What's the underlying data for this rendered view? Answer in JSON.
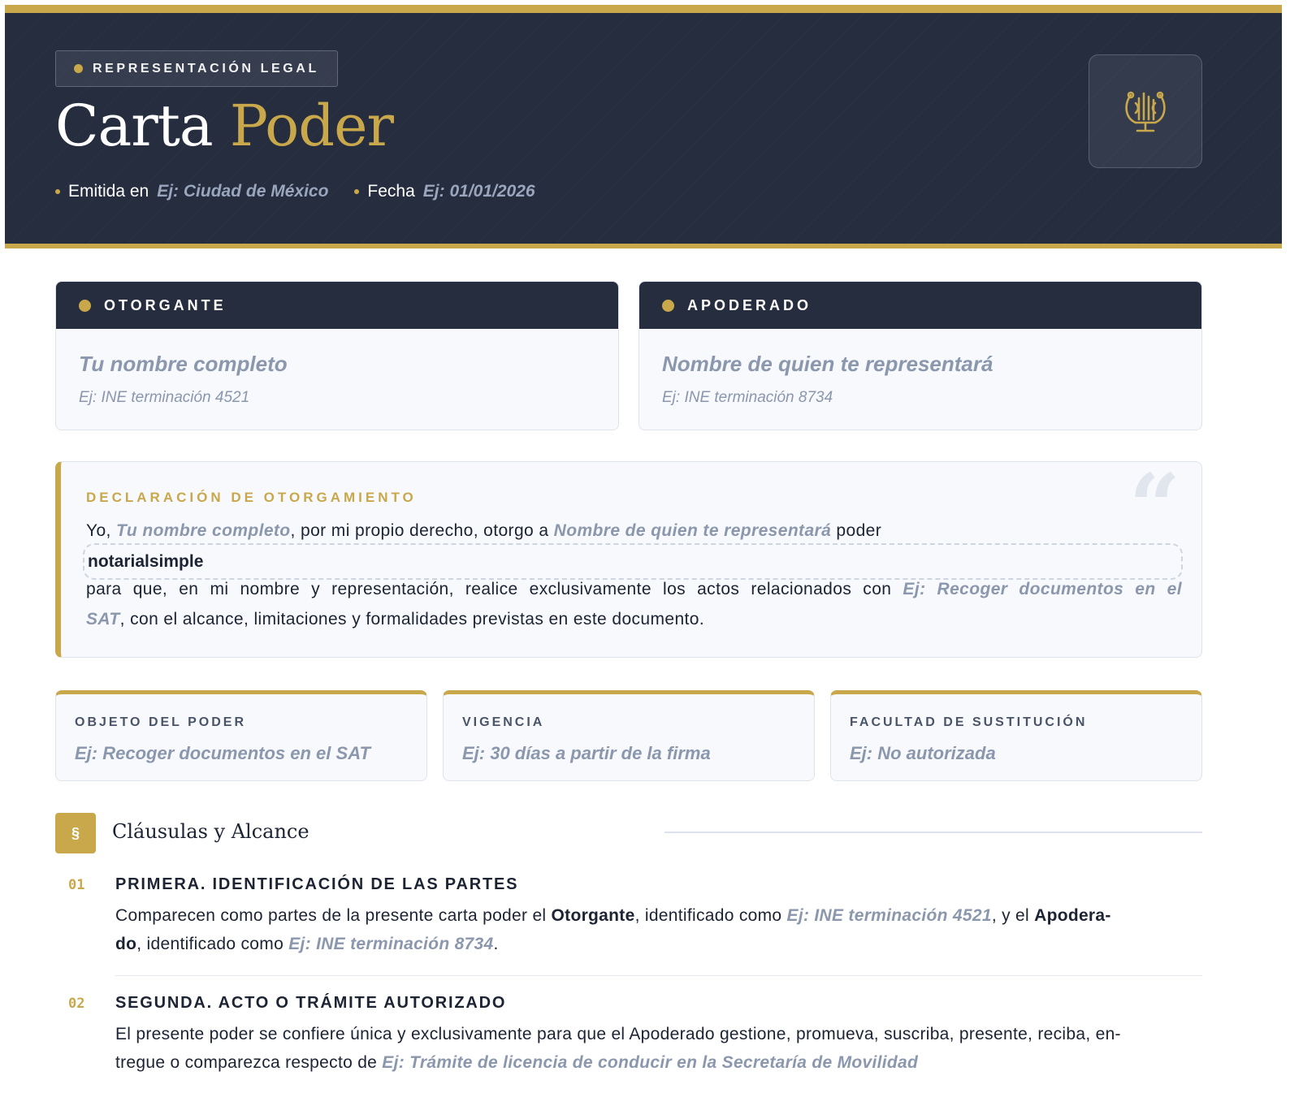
{
  "header": {
    "badge": "REPRESENTACIÓN LEGAL",
    "title_part1": "Carta",
    "title_part2": "Poder",
    "issued_label": "Emitida en",
    "issued_value": "Ej: Ciudad de México",
    "date_label": "Fecha",
    "date_value": "Ej: 01/01/2026",
    "emblem_icon": "lyre-icon"
  },
  "parties": {
    "otorgante": {
      "label": "OTORGANTE",
      "name": "Tu nombre completo",
      "id": "Ej: INE terminación 4521"
    },
    "apoderado": {
      "label": "APODERADO",
      "name": "Nombre de quien te representará",
      "id": "Ej: INE terminación 8734"
    }
  },
  "declaration": {
    "title": "DECLARACIÓN DE OTORGAMIENTO",
    "quote_mark": "“",
    "yo": "Yo,",
    "otorgante": "Tu nombre completo",
    "mid": ", por mi propio derecho, otorgo a",
    "apoderado": "Nombre de quien te representará",
    "poder": "poder",
    "type": "notarialsimple",
    "line3_text": "para que, en mi nombre y representación, realice exclusivamente los actos relacionados con",
    "line3_ph": "Ej: Recoger documentos en el",
    "line4_ph": "SAT",
    "line4_text": ", con el alcance, limitaciones y formalidades previstas en este documento."
  },
  "info_cards": [
    {
      "title": "OBJETO DEL PODER",
      "value": "Ej: Recoger documentos en el SAT"
    },
    {
      "title": "VIGENCIA",
      "value": "Ej: 30 días a partir de la firma"
    },
    {
      "title": "FACULTAD DE SUSTITUCIÓN",
      "value": "Ej: No autorizada"
    }
  ],
  "section": {
    "icon": "§",
    "title": "Cláusulas y Alcance"
  },
  "clauses": [
    {
      "num": "01",
      "title": "PRIMERA. IDENTIFICACIÓN DE LAS PARTES",
      "t1": "Comparecen como partes de la presente carta poder el",
      "b1": "Otorgante",
      "t2": ", identificado como",
      "p1": "Ej: INE terminación 4521",
      "t3": ", y el",
      "b2": "Apodera-",
      "b3": "do",
      "t4": ", identificado como",
      "p2": "Ej: INE terminación 8734",
      "t5": "."
    },
    {
      "num": "02",
      "title": "SEGUNDA. ACTO O TRÁMITE AUTORIZADO",
      "t1": "El presente poder se confiere única y exclusivamente para que el Apoderado gestione, promueva, suscriba, presente, reciba, en-",
      "t2": "tregue o comparezca respecto de",
      "p1": "Ej: Trámite de licencia de conducir en la Secretaría de Movilidad"
    }
  ],
  "colors": {
    "navy": "#252d3f",
    "gold": "#c9a84c",
    "placeholder": "#8a97ad"
  }
}
